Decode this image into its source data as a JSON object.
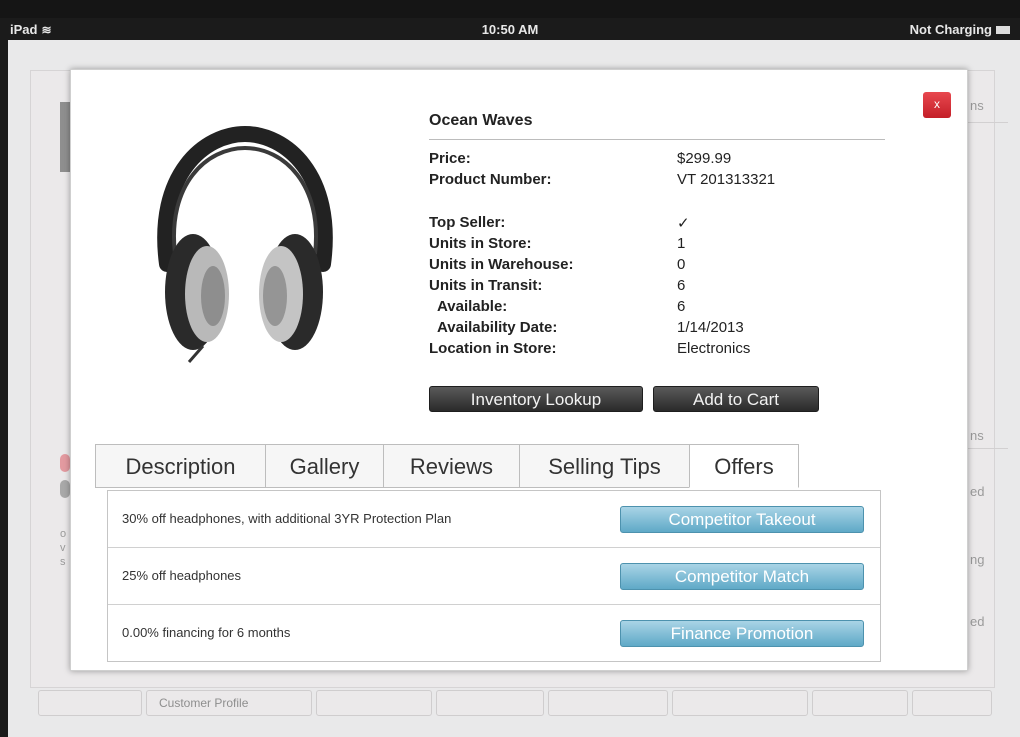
{
  "statusbar": {
    "device": "iPad",
    "time": "10:50 AM",
    "battery": "Not Charging"
  },
  "background": {
    "side_labels": [
      "ns",
      "ns",
      "ed",
      "ng",
      "ed"
    ],
    "left_labels": [
      "o",
      "v",
      "s"
    ],
    "bottom_tabs": [
      "",
      "Customer Profile",
      "",
      "",
      "",
      "",
      "",
      ""
    ]
  },
  "modal": {
    "close_label": "x",
    "product_name": "Ocean Waves",
    "specs": [
      {
        "label": "Price:",
        "value": "$299.99"
      },
      {
        "label": "Product Number:",
        "value": "VT 201313321"
      },
      {
        "label": "Top Seller:",
        "value": "✓"
      },
      {
        "label": "Units in Store:",
        "value": "1"
      },
      {
        "label": "Units in Warehouse:",
        "value": "0"
      },
      {
        "label": "Units in Transit:",
        "value": "6"
      },
      {
        "label": "Available:",
        "value": "6"
      },
      {
        "label": "Availability Date:",
        "value": "1/14/2013"
      },
      {
        "label": "Location in Store:",
        "value": "Electronics"
      }
    ],
    "buttons": {
      "inventory_lookup": "Inventory Lookup",
      "add_to_cart": "Add to Cart"
    },
    "tabs": [
      "Description",
      "Gallery",
      "Reviews",
      "Selling Tips",
      "Offers"
    ],
    "active_tab": "Offers",
    "offers": [
      {
        "text": "30% off headphones, with additional 3YR Protection Plan",
        "button": "Competitor Takeout"
      },
      {
        "text": "25% off headphones",
        "button": "Competitor Match"
      },
      {
        "text": "0.00% financing for 6 months",
        "button": "Finance Promotion"
      }
    ]
  },
  "colors": {
    "close_red": "#d42a33",
    "offer_button_blue": "#6fb3cf",
    "dark_button": "#3a3a3a"
  }
}
